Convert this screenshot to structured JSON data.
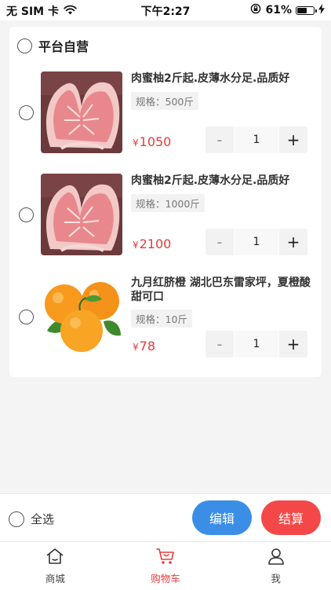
{
  "status_bar": {
    "carrier": "无 SIM 卡",
    "time": "下午2:27",
    "battery_percent": "61%",
    "battery_level": 0.61
  },
  "shop": {
    "name": "平台自营"
  },
  "items": [
    {
      "title": "肉蜜柚2斤起.皮薄水分足.品质好",
      "spec": "规格：500斤",
      "currency": "¥",
      "price": "1050",
      "qty": "1",
      "image": "pomelo-image"
    },
    {
      "title": "肉蜜柚2斤起.皮薄水分足.品质好",
      "spec": "规格：1000斤",
      "currency": "¥",
      "price": "2100",
      "qty": "1",
      "image": "pomelo-image"
    },
    {
      "title": "九月红脐橙 湖北巴东雷家坪，夏橙酸甜可口",
      "spec": "规格：10斤",
      "currency": "¥",
      "price": "78",
      "qty": "1",
      "image": "orange-image"
    }
  ],
  "stepper": {
    "minus": "-",
    "plus": "+"
  },
  "bottom_bar": {
    "select_all": "全选",
    "edit": "编辑",
    "checkout": "结算"
  },
  "tabs": [
    {
      "label": "商城",
      "icon": "home-icon"
    },
    {
      "label": "购物车",
      "icon": "cart-icon"
    },
    {
      "label": "我",
      "icon": "user-icon"
    }
  ],
  "colors": {
    "accent_red": "#e83a3a",
    "edit_blue": "#3a8ee6",
    "checkout_red": "#f44848"
  }
}
